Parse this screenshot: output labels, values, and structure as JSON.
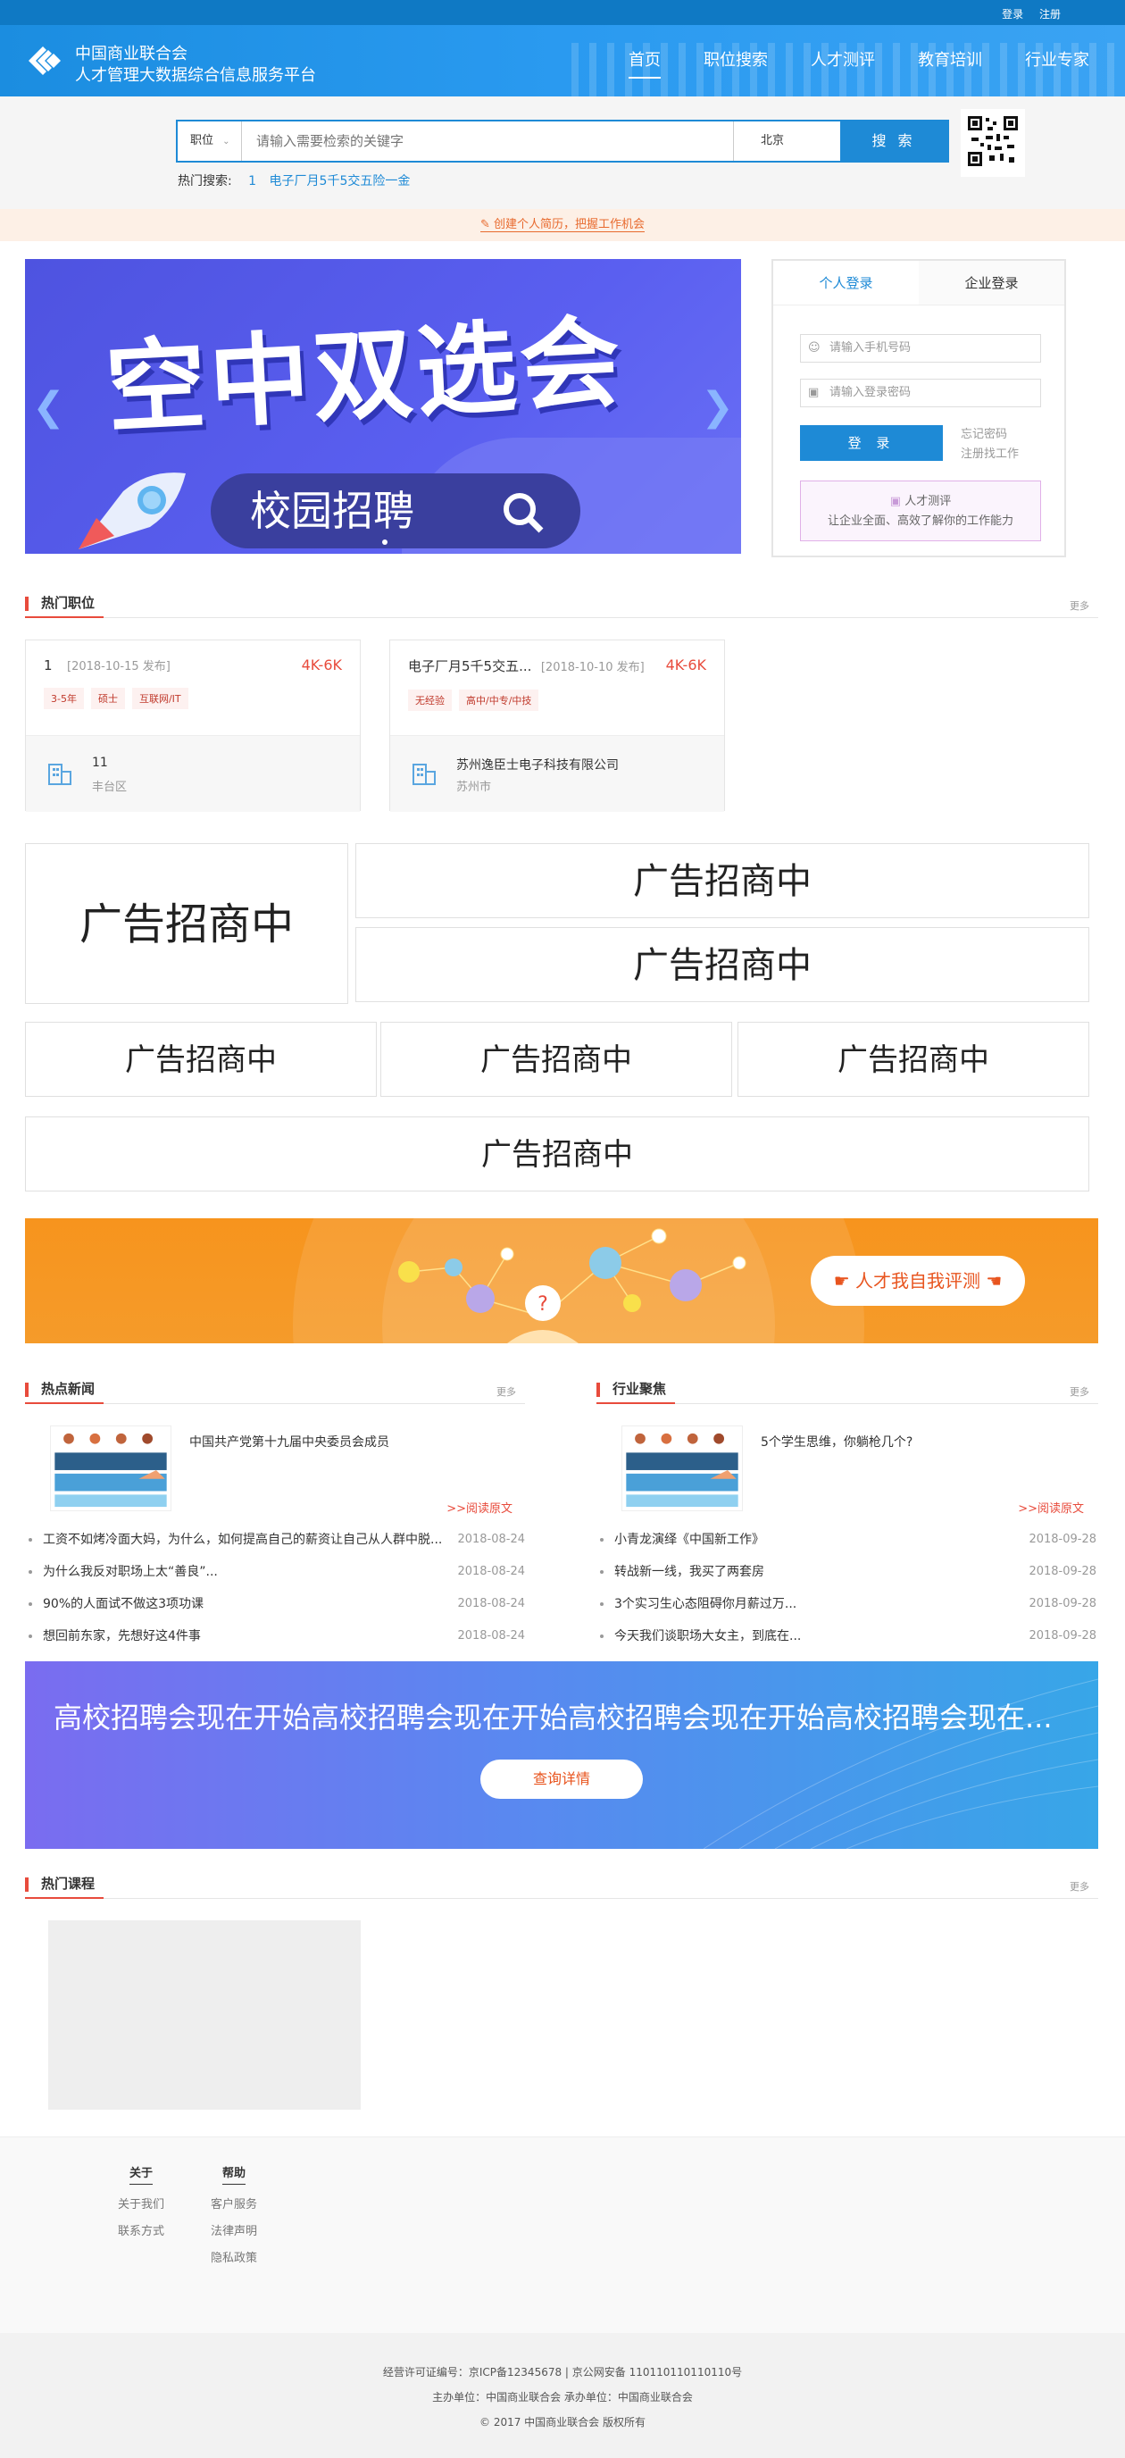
{
  "topbar": {
    "login": "登录",
    "register": "注册"
  },
  "header": {
    "org_name": "中国商业联合会",
    "platform_name": "人才管理大数据综合信息服务平台",
    "nav": [
      "首页",
      "职位搜索",
      "人才测评",
      "教育培训",
      "行业专家"
    ]
  },
  "search": {
    "category": "职位",
    "placeholder": "请输入需要检索的关键字",
    "city": "北京",
    "button": "搜 索",
    "hot_label": "热门搜索:",
    "hot_keywords": [
      "1",
      "电子厂月5千5交五险一金"
    ]
  },
  "notice": {
    "text": "创建个人简历，把握工作机会"
  },
  "banner": {
    "headline": "空中双选会",
    "subline": "校园招聘"
  },
  "login": {
    "tab_personal": "个人登录",
    "tab_company": "企业登录",
    "phone_placeholder": "请输入手机号码",
    "password_placeholder": "请输入登录密码",
    "button": "登 录",
    "forgot": "忘记密码",
    "register_job": "注册找工作",
    "test_title": "人才测评",
    "test_desc": "让企业全面、高效了解你的工作能力"
  },
  "hot_jobs": {
    "title": "热门职位",
    "more": "更多",
    "items": [
      {
        "title": "1",
        "date": "[2018-10-15 发布]",
        "salary": "4K-6K",
        "tags": [
          "3-5年",
          "硕士",
          "互联网/IT"
        ],
        "company": "11",
        "address": "丰台区"
      },
      {
        "title": "电子厂月5千5交五...",
        "date": "[2018-10-10 发布]",
        "salary": "4K-6K",
        "tags": [
          "无经验",
          "高中/中专/中技"
        ],
        "company": "苏州逸臣士电子科技有限公司",
        "address": "苏州市"
      }
    ]
  },
  "ads": {
    "label": "广告招商中"
  },
  "talent_banner": {
    "button": "人才我自我评测"
  },
  "hot_news": {
    "title": "热点新闻",
    "more": "更多",
    "feature_title": "中国共产党第十九届中央委员会成员",
    "read_more": ">>阅读原文",
    "items": [
      {
        "text": "工资不如烤冷面大妈，为什么，如何提高自己的薪资让自己从人群中脱...",
        "date": "2018-08-24"
      },
      {
        "text": "为什么我反对职场上太“善良”...",
        "date": "2018-08-24"
      },
      {
        "text": "90%的人面试不做这3项功课",
        "date": "2018-08-24"
      },
      {
        "text": "想回前东家，先想好这4件事",
        "date": "2018-08-24"
      }
    ]
  },
  "industry_focus": {
    "title": "行业聚焦",
    "more": "更多",
    "feature_title": "5个学生思维，你躺枪几个?",
    "read_more": ">>阅读原文",
    "items": [
      {
        "text": "小青龙演绎《中国新工作》",
        "date": "2018-09-28"
      },
      {
        "text": "转战新一线，我买了两套房",
        "date": "2018-09-28"
      },
      {
        "text": "3个实习生心态阻碍你月薪过万...",
        "date": "2018-09-28"
      },
      {
        "text": "今天我们谈职场大女主，到底在...",
        "date": "2018-09-28"
      }
    ]
  },
  "campus_banner": {
    "text": "高校招聘会现在开始高校招聘会现在开始高校招聘会现在开始高校招聘会现在...",
    "button": "查询详情"
  },
  "hot_courses": {
    "title": "热门课程",
    "more": "更多"
  },
  "footer": {
    "about_title": "关于",
    "about_links": [
      "关于我们",
      "联系方式"
    ],
    "help_title": "帮助",
    "help_links": [
      "客户服务",
      "法律声明",
      "隐私政策"
    ],
    "line1": "经营许可证编号：京ICP备12345678 | 京公网安备 110110110110110号",
    "line2": "主办单位：中国商业联合会 承办单位：中国商业联合会",
    "line3": "© 2017 中国商业联合会 版权所有"
  },
  "colors": {
    "primary": "#1e8ad6",
    "accent": "#e84b3c",
    "orange": "#f7941d"
  }
}
